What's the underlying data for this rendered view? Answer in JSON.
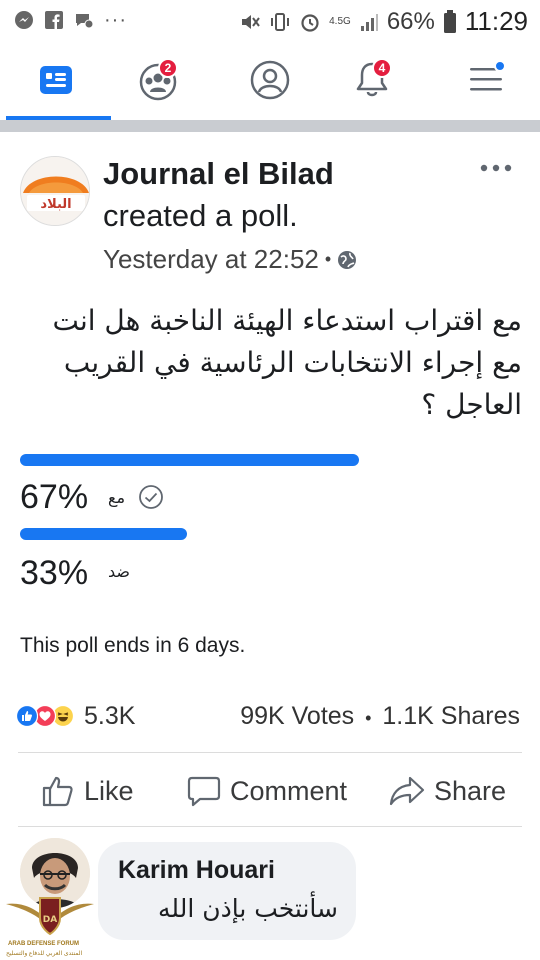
{
  "status_bar": {
    "left_icons": [
      "messenger-icon",
      "facebook-icon",
      "chat-notification-icon"
    ],
    "more": "···",
    "network": "4.5G",
    "battery": "66%",
    "clock": "11:29"
  },
  "nav": {
    "items": [
      {
        "icon": "news-feed-icon",
        "badge": ""
      },
      {
        "icon": "groups-icon",
        "badge": "2"
      },
      {
        "icon": "profile-icon",
        "badge": ""
      },
      {
        "icon": "notifications-bell-icon",
        "badge": "4"
      },
      {
        "icon": "menu-icon",
        "badge": ""
      }
    ],
    "accent": "#1877f2"
  },
  "post": {
    "page_name": "Journal el Bilad",
    "action": "created a poll.",
    "time": "Yesterday at 22:52",
    "separator": "•",
    "avatar_text": "البلاد",
    "question": "مع اقتراب استدعاء الهيئة الناخبة هل انت مع إجراء الانتخابات الرئاسية  في القريب العاجل ؟"
  },
  "poll": {
    "options": [
      {
        "percent": "67%",
        "label": "مع",
        "fraction": 0.67,
        "checked": true
      },
      {
        "percent": "33%",
        "label": "ضد",
        "fraction": 0.33,
        "checked": false
      }
    ],
    "ends": "This poll ends in 6 days."
  },
  "engagement": {
    "reactions": [
      "like",
      "love",
      "haha"
    ],
    "reaction_count": "5.3K",
    "votes": "99K Votes",
    "shares": "1.1K Shares",
    "separator": "•"
  },
  "actions": {
    "like": "Like",
    "comment": "Comment",
    "share": "Share"
  },
  "comment": {
    "author": "Karim Houari",
    "text": "سأنتخب بإذن الله"
  },
  "watermark": {
    "title": "ARAB DEFENSE FORUM",
    "subtitle": "المنتدى العربي للدفاع والتسليح",
    "mark": "DA"
  }
}
